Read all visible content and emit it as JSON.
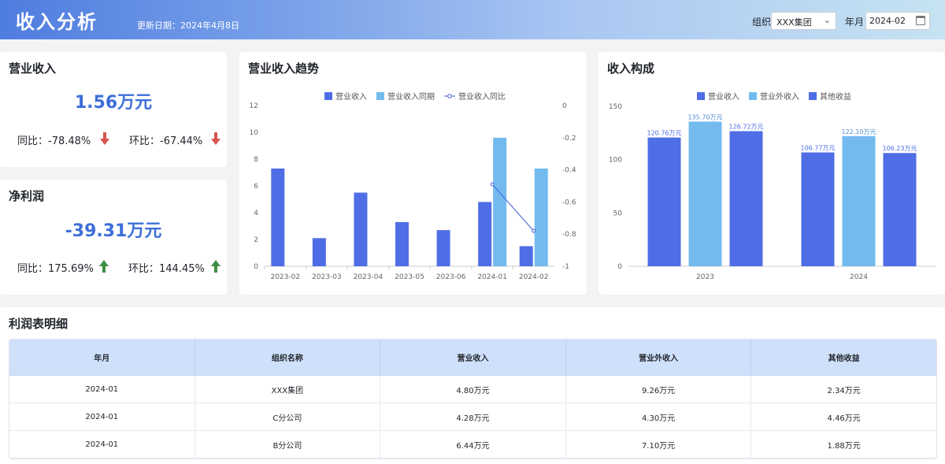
{
  "header": {
    "title": "收入分析",
    "update_text": "更新日期：2024年4月8日",
    "org_label": "组织",
    "org_value": "XXX集团",
    "ym_label": "年月",
    "ym_value": "2024-02"
  },
  "revenue_card": {
    "title": "营业收入",
    "value": "1.56万元",
    "yoy": "同比：-78.48%",
    "mom": "环比：-67.44%",
    "yoy_direction": "down",
    "mom_direction": "down"
  },
  "profit_card": {
    "title": "净利润",
    "value": "-39.31万元",
    "yoy": "同比：175.69%",
    "mom": "环比：144.45%",
    "yoy_direction": "up",
    "mom_direction": "up"
  },
  "colors": {
    "primary_bar": "#4f6ee6",
    "light_bar": "#73bbef",
    "line": "#3f5fd6",
    "down_arrow": "#d9534f",
    "up_arrow": "#3e8e41",
    "kpi_value": "#3d6fd9"
  },
  "chart_data": [
    {
      "title": "营业收入趋势",
      "type": "bar",
      "categories": [
        "2023-02",
        "2023-03",
        "2023-04",
        "2023-05",
        "2023-06",
        "2024-01",
        "2024-02"
      ],
      "series": [
        {
          "name": "营业收入",
          "type": "bar",
          "values": [
            7.3,
            2.1,
            5.5,
            3.3,
            2.7,
            4.8,
            1.5
          ]
        },
        {
          "name": "营业收入同期",
          "type": "bar",
          "values": [
            null,
            null,
            null,
            null,
            null,
            9.6,
            7.3
          ]
        },
        {
          "name": "营业收入同比",
          "type": "line",
          "axis": "right",
          "values": [
            null,
            null,
            null,
            null,
            null,
            -0.49,
            -0.78
          ]
        }
      ],
      "y_left": {
        "ticks": [
          "0",
          "2",
          "4",
          "6",
          "8",
          "10",
          "12"
        ],
        "range": [
          0,
          12
        ]
      },
      "y_right": {
        "ticks": [
          "-1",
          "-0.8",
          "-0.6",
          "-0.4",
          "-0.2",
          "0"
        ],
        "range": [
          -1,
          0
        ]
      },
      "legend_position": "top"
    },
    {
      "title": "收入构成",
      "type": "bar",
      "categories": [
        "2023",
        "2024"
      ],
      "series": [
        {
          "name": "营业收入",
          "values": [
            120.76,
            106.77
          ],
          "labels": [
            "120.76万元",
            "106.77万元"
          ]
        },
        {
          "name": "营业外收入",
          "values": [
            135.7,
            122.1
          ],
          "labels": [
            "135.70万元",
            "122.10万元"
          ]
        },
        {
          "name": "其他收益",
          "values": [
            126.72,
            106.23
          ],
          "labels": [
            "126.72万元",
            "106.23万元"
          ]
        }
      ],
      "y": {
        "ticks": [
          "0",
          "50",
          "100",
          "150"
        ],
        "range": [
          0,
          150
        ]
      },
      "legend_position": "top"
    }
  ],
  "table": {
    "title": "利润表明细",
    "headers": [
      "年月",
      "组织名称",
      "营业收入",
      "营业外收入",
      "其他收益"
    ],
    "rows": [
      [
        "2024-01",
        "XXX集团",
        "4.80万元",
        "9.26万元",
        "2.34万元"
      ],
      [
        "2024-01",
        "C分公司",
        "4.28万元",
        "4.30万元",
        "4.46万元"
      ],
      [
        "2024-01",
        "B分公司",
        "6.44万元",
        "7.10万元",
        "1.88万元"
      ]
    ]
  }
}
